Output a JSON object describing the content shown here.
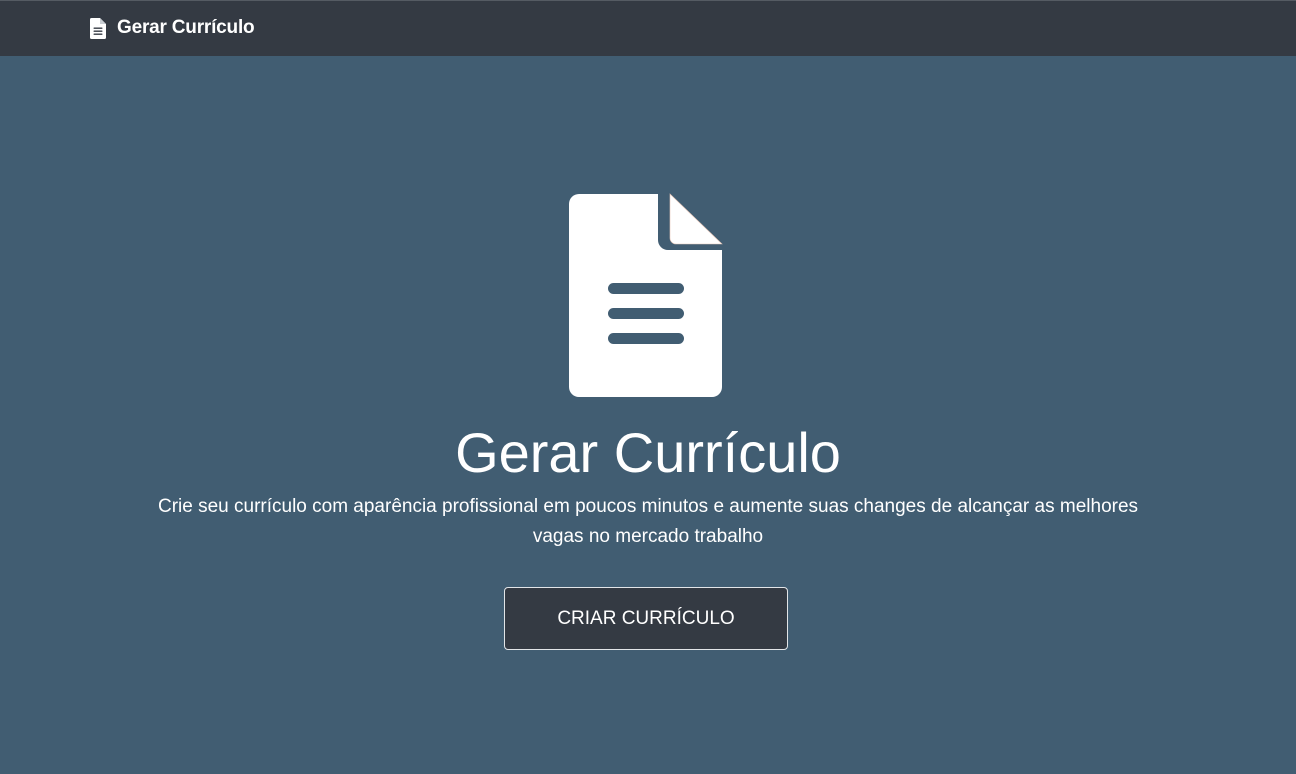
{
  "navbar": {
    "brand_icon": "document-icon",
    "brand_text": "Gerar Currículo"
  },
  "hero": {
    "icon": "document-icon",
    "title": "Gerar Currículo",
    "description": "Crie seu currículo com aparência profissional em poucos minutos e aumente suas changes de alcançar as melhores vagas no mercado trabalho",
    "cta_label": "CRIAR CURRÍCULO"
  },
  "colors": {
    "background": "#415d72",
    "navbar": "#343a43",
    "button": "#343a43",
    "text": "#ffffff"
  }
}
